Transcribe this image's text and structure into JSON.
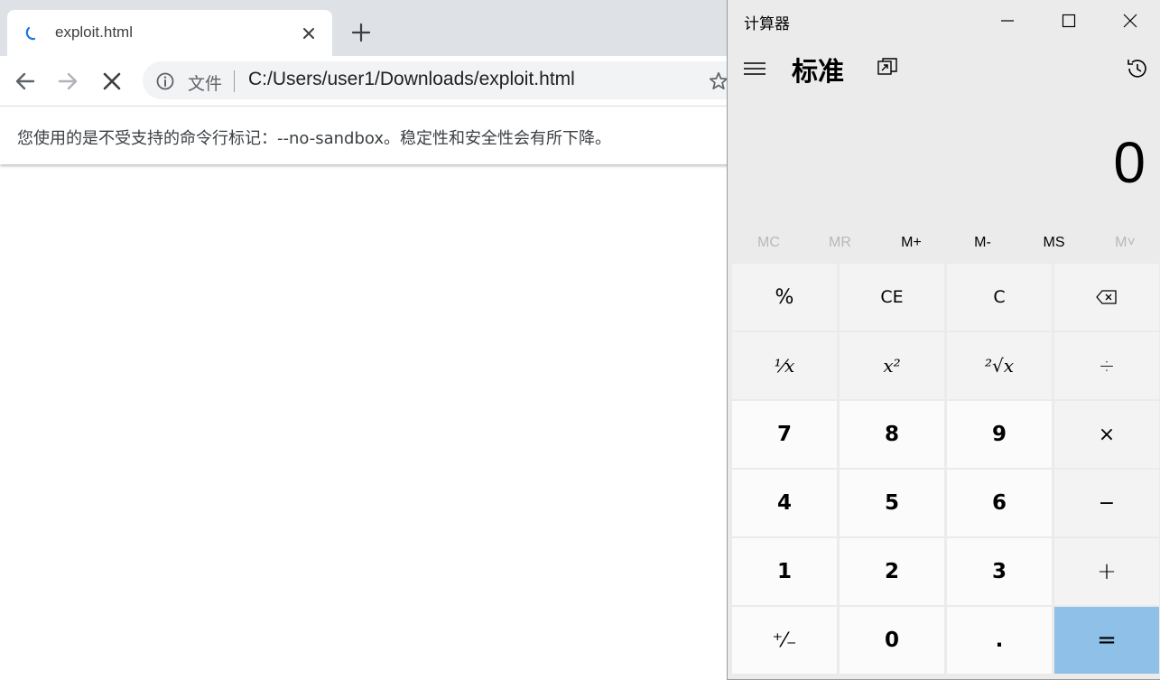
{
  "browser": {
    "tab": {
      "title": "exploit.html"
    },
    "omnibox": {
      "scheme_label": "文件",
      "url": "C:/Users/user1/Downloads/exploit.html"
    },
    "infobar": {
      "message": "您使用的是不受支持的命令行标记：--no-sandbox。稳定性和安全性会有所下降。"
    }
  },
  "calculator": {
    "window_title": "计算器",
    "mode": "标准",
    "display_value": "0",
    "memory": [
      {
        "label": "MC",
        "enabled": false
      },
      {
        "label": "MR",
        "enabled": false
      },
      {
        "label": "M+",
        "enabled": true
      },
      {
        "label": "M-",
        "enabled": true
      },
      {
        "label": "MS",
        "enabled": true
      },
      {
        "label": "M˅",
        "enabled": false
      }
    ],
    "keys": {
      "percent": "%",
      "ce": "CE",
      "c": "C",
      "backspace": "⌫",
      "reciprocal": "¹⁄x",
      "square": "x²",
      "sqrt": "²√x",
      "divide": "÷",
      "seven": "7",
      "eight": "8",
      "nine": "9",
      "multiply": "×",
      "four": "4",
      "five": "5",
      "six": "6",
      "minus": "−",
      "one": "1",
      "two": "2",
      "three": "3",
      "plus": "+",
      "negate": "⁺⁄₋",
      "zero": "0",
      "decimal": ".",
      "equals": "="
    },
    "colors": {
      "equals_bg": "#8ec0e8",
      "func_key_bg": "#f3f3f3",
      "num_key_bg": "#fbfbfb"
    }
  }
}
